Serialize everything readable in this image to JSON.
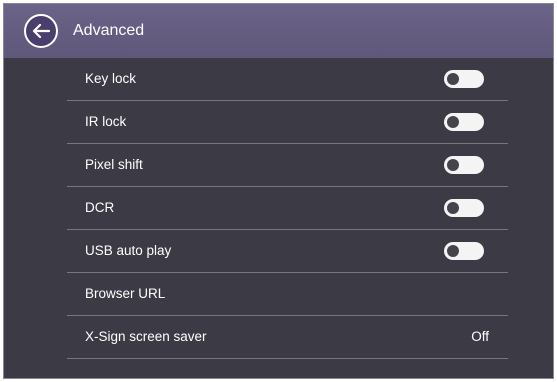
{
  "header": {
    "title": "Advanced",
    "back_icon": "arrow-left-icon"
  },
  "settings": [
    {
      "label": "Key lock",
      "type": "toggle",
      "on": false
    },
    {
      "label": "IR lock",
      "type": "toggle",
      "on": false
    },
    {
      "label": "Pixel shift",
      "type": "toggle",
      "on": false
    },
    {
      "label": "DCR",
      "type": "toggle",
      "on": false
    },
    {
      "label": "USB auto play",
      "type": "toggle",
      "on": false
    },
    {
      "label": "Browser URL",
      "type": "link"
    },
    {
      "label": "X-Sign screen saver",
      "type": "value",
      "value": "Off"
    }
  ],
  "colors": {
    "background": "#3c3b45",
    "header": "#6c6388",
    "divider": "#77767e",
    "toggle_track_off": "#f4f4f4",
    "toggle_knob_off": "#45444d"
  }
}
